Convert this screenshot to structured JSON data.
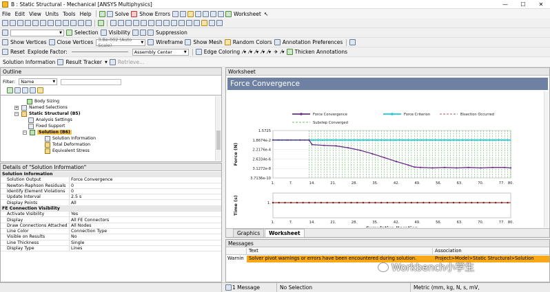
{
  "window": {
    "title": "B : Static Structural - Mechanical [ANSYS Multiphysics]"
  },
  "menu": [
    "File",
    "Edit",
    "View",
    "Units",
    "Tools",
    "Help"
  ],
  "toolbar1": {
    "solve": "Solve",
    "show_errors": "Show Errors",
    "worksheet": "Worksheet"
  },
  "toolbar3": {
    "selection": "Selection",
    "visibility": "Visibility",
    "suppression": "Suppression"
  },
  "toolbar4": {
    "show_vertices": "Show Vertices",
    "close_vertices": "Close Vertices",
    "auto_scale": "3.8e-002 (Auto Scale)",
    "wireframe": "Wireframe",
    "show_mesh": "Show Mesh",
    "random_colors": "Random Colors",
    "annotation_prefs": "Annotation Preferences"
  },
  "toolbar5": {
    "reset": "Reset",
    "explode_factor": "Explode Factor:",
    "assembly_center": "Assembly Center",
    "edge_coloring": "Edge Coloring",
    "thicken": "Thicken Annotations"
  },
  "context": {
    "solution_information": "Solution Information",
    "result_tracker": "Result Tracker",
    "retrieve": "Retrieve..."
  },
  "outline": {
    "title": "Outline",
    "filter_label": "Filter:",
    "filter_value": "Name",
    "nodes": [
      "Body Sizing",
      "Named Selections",
      "Static Structural (B5)",
      "Analysis Settings",
      "Fixed Support",
      "Solution (B6)",
      "Solution Information",
      "Total Deformation",
      "Equivalent Stress"
    ]
  },
  "details": {
    "title": "Details of \"Solution Information\"",
    "rows": [
      {
        "section": true,
        "k": "Solution Information",
        "v": ""
      },
      {
        "k": "Solution Output",
        "v": "Force Convergence"
      },
      {
        "k": "Newton-Raphson Residuals",
        "v": "0"
      },
      {
        "k": "Identify Element Violations",
        "v": "0"
      },
      {
        "k": "Update Interval",
        "v": "2.5 s"
      },
      {
        "k": "Display Points",
        "v": "All"
      },
      {
        "section": true,
        "k": "FE Connection Visibility",
        "v": ""
      },
      {
        "k": "Activate Visibility",
        "v": "Yes"
      },
      {
        "k": "Display",
        "v": "All FE Connectors"
      },
      {
        "k": "Draw Connections Attached To",
        "v": "All Nodes"
      },
      {
        "k": "Line Color",
        "v": "Connection Type"
      },
      {
        "k": "Visible on Results",
        "v": "No"
      },
      {
        "k": "Line Thickness",
        "v": "Single"
      },
      {
        "k": "Display Type",
        "v": "Lines"
      }
    ]
  },
  "worksheet": {
    "title": "Worksheet",
    "banner": "Force Convergence"
  },
  "chart_data": {
    "type": "line",
    "legend": [
      "Force Convergence",
      "Force Criterion",
      "Bisection Occurred",
      "Substep Converged"
    ],
    "legend_position": "top",
    "colors": {
      "force_convergence": "#6a2a8c",
      "force_criterion": "#17c8d6",
      "bisection": "#8a2020",
      "substep": "#3aa83a",
      "time": "#7a1010"
    },
    "ylabel": "Force (N)",
    "yticks": [
      "1.5725",
      "1.8674e-2",
      "2.2176e-4",
      "2.6334e-6",
      "3.1272e-8",
      "3.7136e-10"
    ],
    "xlabel": "Cumulative Iteration",
    "xticks": [
      "1.",
      "7.",
      "14.",
      "21.",
      "28.",
      "35.",
      "42.",
      "49.",
      "56.",
      "63.",
      "70.",
      "77.",
      "80."
    ],
    "xlim": [
      1,
      80
    ],
    "force_criterion_level_index": 1,
    "force_convergence": [
      [
        1,
        0.018674
      ],
      [
        3,
        0.018674
      ],
      [
        6,
        0.018674
      ],
      [
        10,
        0.018674
      ],
      [
        13,
        0.018674
      ],
      [
        14,
        0.0022
      ],
      [
        18,
        0.0015
      ],
      [
        22,
        0.0012
      ],
      [
        26,
        0.0005
      ],
      [
        30,
        0.00015
      ],
      [
        34,
        3e-05
      ],
      [
        38,
        5e-06
      ],
      [
        42,
        8e-07
      ],
      [
        46,
        1.5e-07
      ],
      [
        48,
        6e-08
      ],
      [
        50,
        5e-08
      ],
      [
        54,
        4e-08
      ],
      [
        58,
        5e-08
      ],
      [
        62,
        4e-08
      ],
      [
        66,
        5e-08
      ],
      [
        70,
        4e-08
      ],
      [
        74,
        5e-08
      ],
      [
        78,
        5e-08
      ],
      [
        80,
        4e-08
      ]
    ],
    "substep_converged_x": [
      13,
      14,
      15,
      16,
      17,
      18,
      19,
      20,
      21,
      22,
      23,
      24,
      25,
      26,
      27,
      28,
      29,
      30,
      31,
      32,
      33,
      34,
      35,
      36,
      37,
      38,
      39,
      40,
      41,
      42,
      43,
      44,
      45,
      46,
      47,
      48,
      49,
      50,
      51,
      52,
      53,
      54,
      55,
      56,
      57,
      58,
      59,
      60,
      61,
      62,
      63,
      64,
      65,
      66,
      67,
      68,
      69,
      70,
      71,
      72,
      73,
      74,
      75,
      76,
      77,
      78,
      79,
      80
    ],
    "time_ylabel": "Time (s)",
    "time_ytick": "1.",
    "time_xticks": [
      "1.",
      "7.",
      "14.",
      "21.",
      "28.",
      "35.",
      "42.",
      "49.",
      "56.",
      "63.",
      "70.",
      "77.",
      "80."
    ]
  },
  "tabs": [
    "Graphics",
    "Worksheet"
  ],
  "messages": {
    "title": "Messages",
    "col_text": "Text",
    "col_assoc": "Association",
    "row_type": "Warnin",
    "row_text": "Solver pivot warnings or errors have been encountered during solution.",
    "row_assoc": "Project>Model>Static Structural>Solution"
  },
  "status": {
    "messages": "1 Message",
    "selection": "No Selection",
    "units": "Metric (mm, kg, N, s, mV,"
  },
  "watermark": "Workbench小学生"
}
